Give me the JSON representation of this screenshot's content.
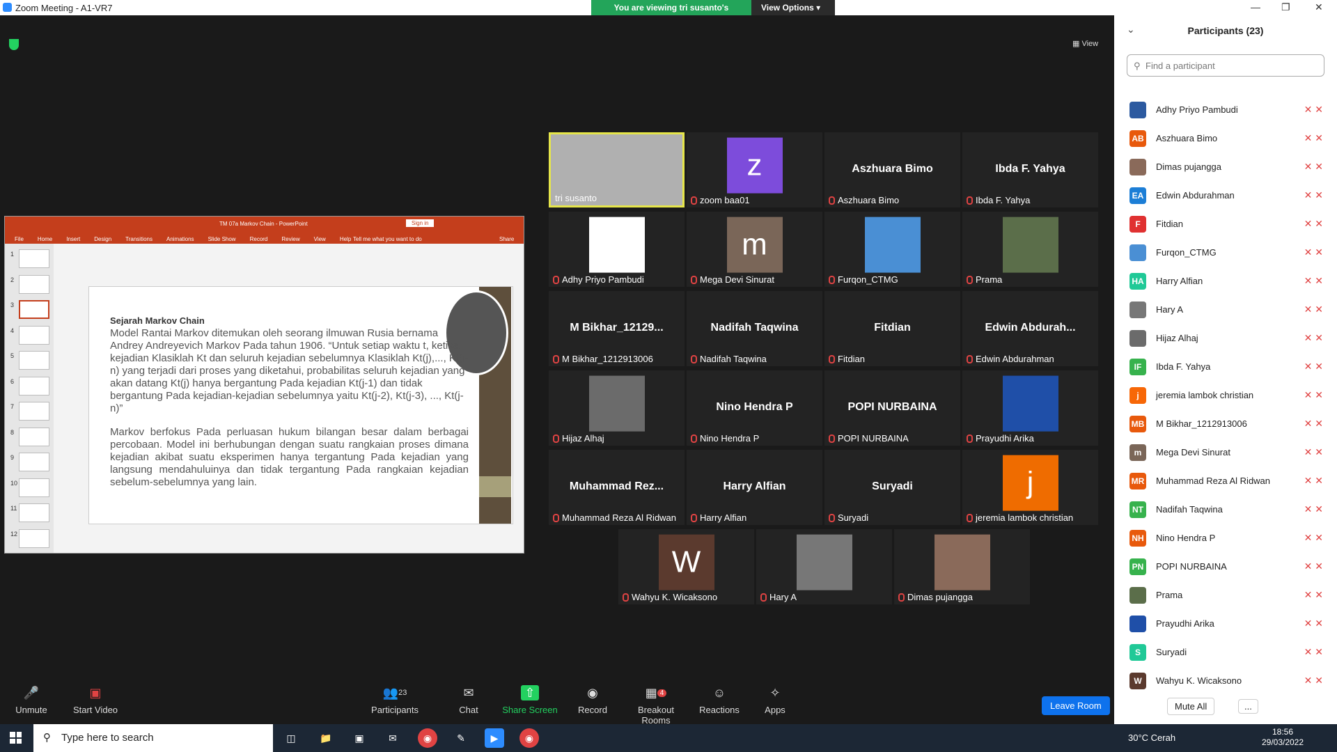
{
  "window": {
    "title": "Zoom Meeting - A1-VR7"
  },
  "banner": {
    "viewing": "You are viewing tri susanto's screen",
    "view_options": "View Options"
  },
  "view_button": "View",
  "ppt": {
    "title": "TM 07a Markov Chain - PowerPoint",
    "sign_in": "Sign in",
    "share": "Share",
    "tell_me": "Tell me what you want to do",
    "tabs": [
      "File",
      "Home",
      "Insert",
      "Design",
      "Transitions",
      "Animations",
      "Slide Show",
      "Record",
      "Review",
      "View",
      "Help"
    ],
    "slide_numbers": [
      "1",
      "2",
      "3",
      "4",
      "5",
      "6",
      "7",
      "8",
      "9",
      "10",
      "11",
      "12"
    ],
    "slide": {
      "heading": "Sejarah Markov Chain",
      "p1": "Model Rantai Markov ditemukan oleh seorang ilmuwan Rusia bernama Andrey Andreyevich Markov Pada tahun 1906. “Untuk setiap waktu t, ketika kejadian Klasiklah Kt dan seluruh kejadian sebelumnya Klasiklah Kt(j),..., Kt(j-n) yang terjadi dari proses yang diketahui, probabilitas seluruh kejadian yang akan datang Kt(j) hanya bergantung Pada kejadian Kt(j-1) dan tidak bergantung Pada kejadian-kejadian sebelumnya yaitu Kt(j-2), Kt(j-3), ..., Kt(j-n)”",
      "p2": "Markov berfokus Pada perluasan hukum bilangan besar dalam berbagai percobaan. Model ini berhubungan dengan suatu rangkaian proses dimana kejadian akibat suatu eksperimen hanya tergantung Pada kejadian yang langsung mendahuluinya dan tidak tergantung Pada rangkaian kejadian sebelum-sebelumnya yang lain."
    }
  },
  "tiles": [
    {
      "name": "tri susanto",
      "big": "",
      "avatar": "",
      "color": "#b0b0b0"
    },
    {
      "name": "zoom baa01",
      "big": "",
      "avatar": "z",
      "color": "#7d4cdb"
    },
    {
      "name": "Aszhuara Bimo",
      "big": "Aszhuara Bimo",
      "avatar": "",
      "color": ""
    },
    {
      "name": "Ibda F. Yahya",
      "big": "Ibda F. Yahya",
      "avatar": "",
      "color": ""
    },
    {
      "name": "Adhy Priyo Pambudi",
      "big": "",
      "avatar": "",
      "color": "#ffffff"
    },
    {
      "name": "Mega Devi Sinurat",
      "big": "",
      "avatar": "m",
      "color": "#7a6658"
    },
    {
      "name": "Furqon_CTMG",
      "big": "",
      "avatar": "",
      "color": "#4a8fd4"
    },
    {
      "name": "Prama",
      "big": "",
      "avatar": "",
      "color": "#5b6e4a"
    },
    {
      "name": "M Bikhar_1212913006",
      "big": "M Bikhar_12129...",
      "avatar": "",
      "color": ""
    },
    {
      "name": "Nadifah Taqwina",
      "big": "Nadifah Taqwina",
      "avatar": "",
      "color": ""
    },
    {
      "name": "Fitdian",
      "big": "Fitdian",
      "avatar": "",
      "color": ""
    },
    {
      "name": "Edwin Abdurahman",
      "big": "Edwin Abdurah...",
      "avatar": "",
      "color": ""
    },
    {
      "name": "Hijaz Alhaj",
      "big": "",
      "avatar": "",
      "color": "#6b6b6b"
    },
    {
      "name": "Nino Hendra P",
      "big": "Nino Hendra P",
      "avatar": "",
      "color": ""
    },
    {
      "name": "POPI NURBAINA",
      "big": "POPI NURBAINA",
      "avatar": "",
      "color": ""
    },
    {
      "name": "Prayudhi Arika",
      "big": "",
      "avatar": "",
      "color": "#1f4fa8"
    },
    {
      "name": "Muhammad Reza Al Ridwan",
      "big": "Muhammad Rez...",
      "avatar": "",
      "color": ""
    },
    {
      "name": "Harry Alfian",
      "big": "Harry Alfian",
      "avatar": "",
      "color": ""
    },
    {
      "name": "Suryadi",
      "big": "Suryadi",
      "avatar": "",
      "color": ""
    },
    {
      "name": "jeremia lambok christian",
      "big": "",
      "avatar": "j",
      "color": "#ef6c00"
    },
    {
      "name": "Wahyu K. Wicaksono",
      "big": "",
      "avatar": "W",
      "color": "#5b3a2e"
    },
    {
      "name": "Hary A",
      "big": "",
      "avatar": "",
      "color": "#777777"
    },
    {
      "name": "Dimas pujangga",
      "big": "",
      "avatar": "",
      "color": "#8a6a5a"
    }
  ],
  "toolbar": {
    "unmute": "Unmute",
    "start_video": "Start Video",
    "participants": "Participants",
    "participants_count": "23",
    "chat": "Chat",
    "share": "Share Screen",
    "record": "Record",
    "breakout": "Breakout Rooms",
    "breakout_badge": "4",
    "reactions": "Reactions",
    "apps": "Apps",
    "leave": "Leave Room"
  },
  "panel": {
    "title": "Participants (23)",
    "search_placeholder": "Find a participant",
    "mute_all": "Mute All",
    "more": "...",
    "people": [
      {
        "name": "Adhy Priyo Pambudi",
        "initials": "",
        "color": "#2c5aa0"
      },
      {
        "name": "Aszhuara Bimo",
        "initials": "AB",
        "color": "#e8590c"
      },
      {
        "name": "Dimas pujangga",
        "initials": "",
        "color": "#8a6a5a"
      },
      {
        "name": "Edwin Abdurahman",
        "initials": "EA",
        "color": "#1c7ed6"
      },
      {
        "name": "Fitdian",
        "initials": "F",
        "color": "#e03131"
      },
      {
        "name": "Furqon_CTMG",
        "initials": "",
        "color": "#4a8fd4"
      },
      {
        "name": "Harry Alfian",
        "initials": "HA",
        "color": "#20c997"
      },
      {
        "name": "Hary A",
        "initials": "",
        "color": "#777777"
      },
      {
        "name": "Hijaz Alhaj",
        "initials": "",
        "color": "#6b6b6b"
      },
      {
        "name": "Ibda F. Yahya",
        "initials": "IF",
        "color": "#37b24d"
      },
      {
        "name": "jeremia lambok christian",
        "initials": "j",
        "color": "#f76707"
      },
      {
        "name": "M Bikhar_1212913006",
        "initials": "MB",
        "color": "#e8590c"
      },
      {
        "name": "Mega Devi Sinurat",
        "initials": "m",
        "color": "#7a6658"
      },
      {
        "name": "Muhammad Reza Al Ridwan",
        "initials": "MR",
        "color": "#e8590c"
      },
      {
        "name": "Nadifah Taqwina",
        "initials": "NT",
        "color": "#37b24d"
      },
      {
        "name": "Nino Hendra P",
        "initials": "NH",
        "color": "#e8590c"
      },
      {
        "name": "POPI NURBAINA",
        "initials": "PN",
        "color": "#37b24d"
      },
      {
        "name": "Prama",
        "initials": "",
        "color": "#5b6e4a"
      },
      {
        "name": "Prayudhi Arika",
        "initials": "",
        "color": "#1f4fa8"
      },
      {
        "name": "Suryadi",
        "initials": "S",
        "color": "#20c997"
      },
      {
        "name": "Wahyu K. Wicaksono",
        "initials": "W",
        "color": "#5b3a2e"
      }
    ]
  },
  "taskbar": {
    "search": "Type here to search",
    "weather": "30°C  Cerah",
    "time": "18:56",
    "date": "29/03/2022"
  }
}
